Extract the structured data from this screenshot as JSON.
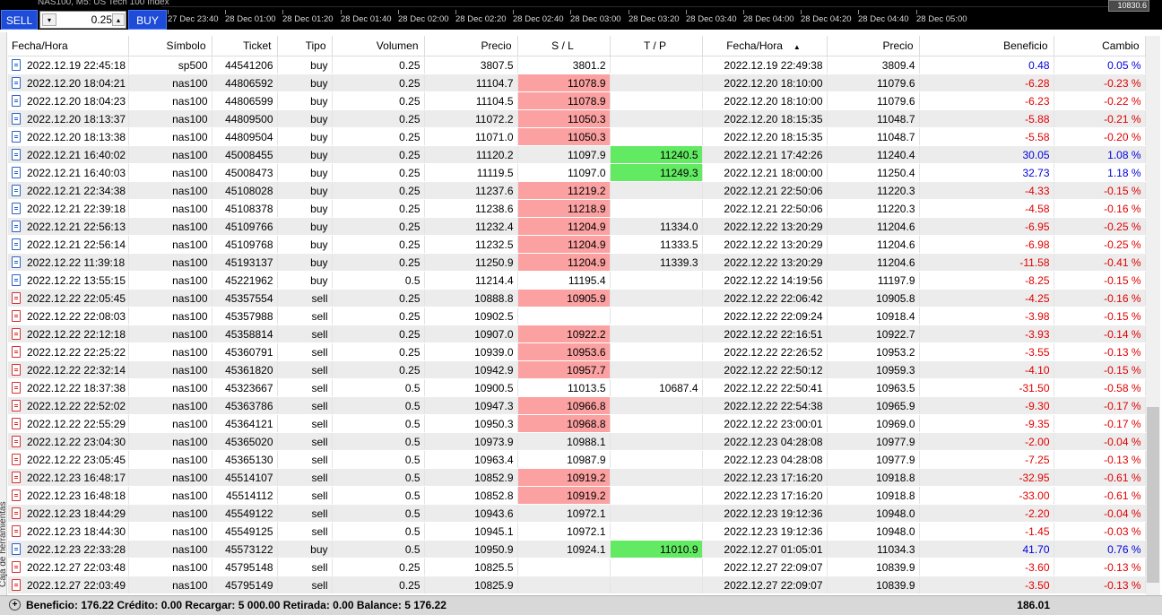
{
  "chart": {
    "title": "NAS100, M5: US Tech 100 Index",
    "price_label": "10830.6",
    "times": [
      "27 Dec 23:40",
      "28 Dec 01:00",
      "28 Dec 01:20",
      "28 Dec 01:40",
      "28 Dec 02:00",
      "28 Dec 02:20",
      "28 Dec 02:40",
      "28 Dec 03:00",
      "28 Dec 03:20",
      "28 Dec 03:40",
      "28 Dec 04:00",
      "28 Dec 04:20",
      "28 Dec 04:40",
      "28 Dec 05:00"
    ]
  },
  "trade_panel": {
    "sell_label": "SELL",
    "buy_label": "BUY",
    "lot_value": "0.25",
    "dropdown_glyph": "▾",
    "spin_glyph": "▴"
  },
  "toolbox_label": "Caja de herramientas",
  "colors": {
    "sl_hit": "#fca1a1",
    "tp_hit": "#63ea63",
    "positive": "#0000dd",
    "negative": "#e00000",
    "button": "#1e4bd8"
  },
  "table": {
    "columns": [
      "Fecha/Hora",
      "Símbolo",
      "Ticket",
      "Tipo",
      "Volumen",
      "Precio",
      "S / L",
      "T / P",
      "Fecha/Hora",
      "Precio",
      "Beneficio",
      "Cambio"
    ],
    "sort_glyph": "▲",
    "rows": [
      [
        "2022.12.19 22:45:18",
        "sp500",
        "44541206",
        "buy",
        "0.25",
        "3807.5",
        "3801.2",
        "",
        "2022.12.19 22:49:38",
        "3809.4",
        "0.48",
        "0.05 %"
      ],
      [
        "2022.12.20 18:04:21",
        "nas100",
        "44806592",
        "buy",
        "0.25",
        "11104.7",
        "11078.9",
        "",
        "2022.12.20 18:10:00",
        "11079.6",
        "-6.28",
        "-0.23 %"
      ],
      [
        "2022.12.20 18:04:23",
        "nas100",
        "44806599",
        "buy",
        "0.25",
        "11104.5",
        "11078.9",
        "",
        "2022.12.20 18:10:00",
        "11079.6",
        "-6.23",
        "-0.22 %"
      ],
      [
        "2022.12.20 18:13:37",
        "nas100",
        "44809500",
        "buy",
        "0.25",
        "11072.2",
        "11050.3",
        "",
        "2022.12.20 18:15:35",
        "11048.7",
        "-5.88",
        "-0.21 %"
      ],
      [
        "2022.12.20 18:13:38",
        "nas100",
        "44809504",
        "buy",
        "0.25",
        "11071.0",
        "11050.3",
        "",
        "2022.12.20 18:15:35",
        "11048.7",
        "-5.58",
        "-0.20 %"
      ],
      [
        "2022.12.21 16:40:02",
        "nas100",
        "45008455",
        "buy",
        "0.25",
        "11120.2",
        "11097.9",
        "11240.5",
        "2022.12.21 17:42:26",
        "11240.4",
        "30.05",
        "1.08 %"
      ],
      [
        "2022.12.21 16:40:03",
        "nas100",
        "45008473",
        "buy",
        "0.25",
        "11119.5",
        "11097.0",
        "11249.3",
        "2022.12.21 18:00:00",
        "11250.4",
        "32.73",
        "1.18 %"
      ],
      [
        "2022.12.21 22:34:38",
        "nas100",
        "45108028",
        "buy",
        "0.25",
        "11237.6",
        "11219.2",
        "",
        "2022.12.21 22:50:06",
        "11220.3",
        "-4.33",
        "-0.15 %"
      ],
      [
        "2022.12.21 22:39:18",
        "nas100",
        "45108378",
        "buy",
        "0.25",
        "11238.6",
        "11218.9",
        "",
        "2022.12.21 22:50:06",
        "11220.3",
        "-4.58",
        "-0.16 %"
      ],
      [
        "2022.12.21 22:56:13",
        "nas100",
        "45109766",
        "buy",
        "0.25",
        "11232.4",
        "11204.9",
        "11334.0",
        "2022.12.22 13:20:29",
        "11204.6",
        "-6.95",
        "-0.25 %"
      ],
      [
        "2022.12.21 22:56:14",
        "nas100",
        "45109768",
        "buy",
        "0.25",
        "11232.5",
        "11204.9",
        "11333.5",
        "2022.12.22 13:20:29",
        "11204.6",
        "-6.98",
        "-0.25 %"
      ],
      [
        "2022.12.22 11:39:18",
        "nas100",
        "45193137",
        "buy",
        "0.25",
        "11250.9",
        "11204.9",
        "11339.3",
        "2022.12.22 13:20:29",
        "11204.6",
        "-11.58",
        "-0.41 %"
      ],
      [
        "2022.12.22 13:55:15",
        "nas100",
        "45221962",
        "buy",
        "0.5",
        "11214.4",
        "11195.4",
        "",
        "2022.12.22 14:19:56",
        "11197.9",
        "-8.25",
        "-0.15 %"
      ],
      [
        "2022.12.22 22:05:45",
        "nas100",
        "45357554",
        "sell",
        "0.25",
        "10888.8",
        "10905.9",
        "",
        "2022.12.22 22:06:42",
        "10905.8",
        "-4.25",
        "-0.16 %"
      ],
      [
        "2022.12.22 22:08:03",
        "nas100",
        "45357988",
        "sell",
        "0.25",
        "10902.5",
        "",
        "",
        "2022.12.22 22:09:24",
        "10918.4",
        "-3.98",
        "-0.15 %"
      ],
      [
        "2022.12.22 22:12:18",
        "nas100",
        "45358814",
        "sell",
        "0.25",
        "10907.0",
        "10922.2",
        "",
        "2022.12.22 22:16:51",
        "10922.7",
        "-3.93",
        "-0.14 %"
      ],
      [
        "2022.12.22 22:25:22",
        "nas100",
        "45360791",
        "sell",
        "0.25",
        "10939.0",
        "10953.6",
        "",
        "2022.12.22 22:26:52",
        "10953.2",
        "-3.55",
        "-0.13 %"
      ],
      [
        "2022.12.22 22:32:14",
        "nas100",
        "45361820",
        "sell",
        "0.25",
        "10942.9",
        "10957.7",
        "",
        "2022.12.22 22:50:12",
        "10959.3",
        "-4.10",
        "-0.15 %"
      ],
      [
        "2022.12.22 18:37:38",
        "nas100",
        "45323667",
        "sell",
        "0.5",
        "10900.5",
        "11013.5",
        "10687.4",
        "2022.12.22 22:50:41",
        "10963.5",
        "-31.50",
        "-0.58 %"
      ],
      [
        "2022.12.22 22:52:02",
        "nas100",
        "45363786",
        "sell",
        "0.5",
        "10947.3",
        "10966.8",
        "",
        "2022.12.22 22:54:38",
        "10965.9",
        "-9.30",
        "-0.17 %"
      ],
      [
        "2022.12.22 22:55:29",
        "nas100",
        "45364121",
        "sell",
        "0.5",
        "10950.3",
        "10968.8",
        "",
        "2022.12.22 23:00:01",
        "10969.0",
        "-9.35",
        "-0.17 %"
      ],
      [
        "2022.12.22 23:04:30",
        "nas100",
        "45365020",
        "sell",
        "0.5",
        "10973.9",
        "10988.1",
        "",
        "2022.12.23 04:28:08",
        "10977.9",
        "-2.00",
        "-0.04 %"
      ],
      [
        "2022.12.22 23:05:45",
        "nas100",
        "45365130",
        "sell",
        "0.5",
        "10963.4",
        "10987.9",
        "",
        "2022.12.23 04:28:08",
        "10977.9",
        "-7.25",
        "-0.13 %"
      ],
      [
        "2022.12.23 16:48:17",
        "nas100",
        "45514107",
        "sell",
        "0.5",
        "10852.9",
        "10919.2",
        "",
        "2022.12.23 17:16:20",
        "10918.8",
        "-32.95",
        "-0.61 %"
      ],
      [
        "2022.12.23 16:48:18",
        "nas100",
        "45514112",
        "sell",
        "0.5",
        "10852.8",
        "10919.2",
        "",
        "2022.12.23 17:16:20",
        "10918.8",
        "-33.00",
        "-0.61 %"
      ],
      [
        "2022.12.23 18:44:29",
        "nas100",
        "45549122",
        "sell",
        "0.5",
        "10943.6",
        "10972.1",
        "",
        "2022.12.23 19:12:36",
        "10948.0",
        "-2.20",
        "-0.04 %"
      ],
      [
        "2022.12.23 18:44:30",
        "nas100",
        "45549125",
        "sell",
        "0.5",
        "10945.1",
        "10972.1",
        "",
        "2022.12.23 19:12:36",
        "10948.0",
        "-1.45",
        "-0.03 %"
      ],
      [
        "2022.12.23 22:33:28",
        "nas100",
        "45573122",
        "buy",
        "0.5",
        "10950.9",
        "10924.1",
        "11010.9",
        "2022.12.27 01:05:01",
        "11034.3",
        "41.70",
        "0.76 %"
      ],
      [
        "2022.12.27 22:03:48",
        "nas100",
        "45795148",
        "sell",
        "0.25",
        "10825.5",
        "",
        "",
        "2022.12.27 22:09:07",
        "10839.9",
        "-3.60",
        "-0.13 %"
      ],
      [
        "2022.12.27 22:03:49",
        "nas100",
        "45795149",
        "sell",
        "0.25",
        "10825.9",
        "",
        "",
        "2022.12.27 22:09:07",
        "10839.9",
        "-3.50",
        "-0.13 %"
      ]
    ],
    "sl_hit_rows": [
      1,
      2,
      3,
      4,
      7,
      8,
      9,
      10,
      11,
      13,
      15,
      16,
      17,
      19,
      20,
      23,
      24
    ],
    "tp_hit_rows": [
      5,
      6,
      27
    ]
  },
  "summary": {
    "icon_glyph": "+",
    "text": "Beneficio: 176.22  Crédito: 0.00  Recargar: 5 000.00  Retirada: 0.00  Balance: 5 176.22",
    "total": "186.01"
  }
}
